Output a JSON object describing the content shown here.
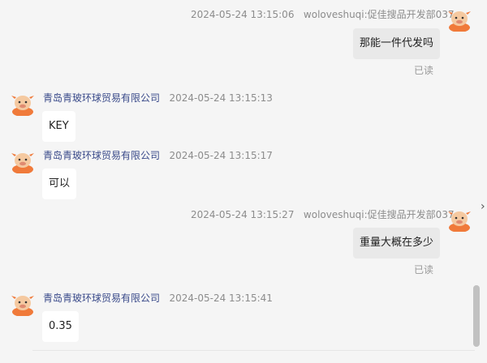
{
  "chat": {
    "messages": [
      {
        "side": "self",
        "time": "2024-05-24 13:15:06",
        "sender": "woloveshuqi:促佳搜品开发部037",
        "text": "那能一件代发吗",
        "status": "已读"
      },
      {
        "side": "other",
        "sender": "青岛青玻环球贸易有限公司",
        "time": "2024-05-24 13:15:13",
        "text": "KEY"
      },
      {
        "side": "other",
        "sender": "青岛青玻环球贸易有限公司",
        "time": "2024-05-24 13:15:17",
        "text": "可以"
      },
      {
        "side": "self",
        "time": "2024-05-24 13:15:27",
        "sender": "woloveshuqi:促佳搜品开发部037",
        "text": "重量大概在多少",
        "status": "已读"
      },
      {
        "side": "other",
        "sender": "青岛青玻环球贸易有限公司",
        "time": "2024-05-24 13:15:41",
        "text": "0.35"
      }
    ]
  },
  "ui": {
    "collapse_icon_glyph": "›",
    "avatar_icon": "cartoon-cow-avatar-icon",
    "colors": {
      "background": "#f5f5f5",
      "self_bubble": "#e9e9e9",
      "other_bubble": "#ffffff",
      "sender_name": "#3a4a8a",
      "avatar_orange": "#f07a3a"
    }
  }
}
